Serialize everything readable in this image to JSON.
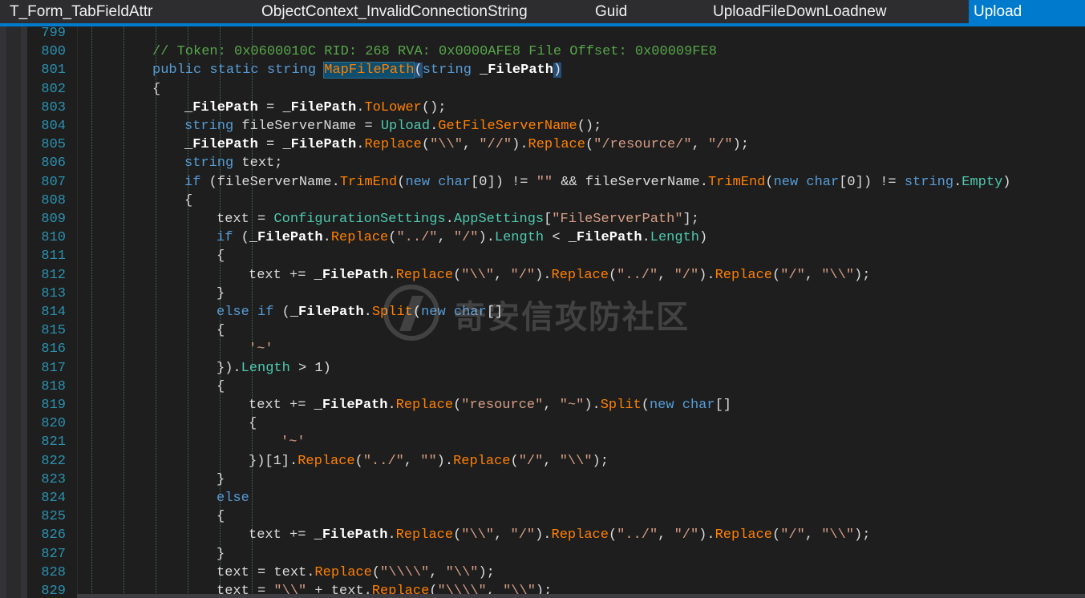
{
  "tabs": [
    {
      "label": "T_Form_TabFieldAttr",
      "active": false
    },
    {
      "label": "ObjectContext_InvalidConnectionString",
      "active": false
    },
    {
      "label": "Guid",
      "active": false
    },
    {
      "label": "UploadFileDownLoadnew",
      "active": false
    },
    {
      "label": "Upload",
      "active": true
    }
  ],
  "colors": {
    "keyword": "#569cd6",
    "comment": "#57a64a",
    "string": "#d69d85",
    "method": "#ff8000",
    "type": "#4ec9b0",
    "line_number": "#2b91af",
    "active_tab": "#007acc"
  },
  "watermark": {
    "text": "奇安信攻防社区",
    "icon": "qianxin-logo-icon"
  },
  "editor": {
    "lines": [
      {
        "n": "799",
        "indent": 0,
        "tokens": []
      },
      {
        "n": "800",
        "indent": 2,
        "tokens": [
          [
            "cm",
            "// Token: 0x0600010C RID: 268 RVA: 0x0000AFE8 File Offset: 0x00009FE8"
          ]
        ]
      },
      {
        "n": "801",
        "indent": 2,
        "tokens": [
          [
            "kw",
            "public"
          ],
          [
            "",
            " "
          ],
          [
            "kw",
            "static"
          ],
          [
            "",
            " "
          ],
          [
            "kw",
            "string"
          ],
          [
            "",
            " "
          ],
          [
            "me hl",
            "MapFilePath"
          ],
          [
            "hl2",
            "("
          ],
          [
            "kw",
            "string"
          ],
          [
            "",
            " "
          ],
          [
            "pa",
            "_FilePath"
          ],
          [
            "hl2",
            ")"
          ]
        ]
      },
      {
        "n": "802",
        "indent": 2,
        "tokens": [
          [
            "",
            "{"
          ]
        ]
      },
      {
        "n": "803",
        "indent": 3,
        "tokens": [
          [
            "pa",
            "_FilePath"
          ],
          [
            "",
            " = "
          ],
          [
            "pa",
            "_FilePath"
          ],
          [
            "",
            "."
          ],
          [
            "me",
            "ToLower"
          ],
          [
            "",
            "();"
          ]
        ]
      },
      {
        "n": "804",
        "indent": 3,
        "tokens": [
          [
            "kw",
            "string"
          ],
          [
            "",
            " fileServerName = "
          ],
          [
            "ty",
            "Upload"
          ],
          [
            "",
            "."
          ],
          [
            "me",
            "GetFileServerName"
          ],
          [
            "",
            "();"
          ]
        ]
      },
      {
        "n": "805",
        "indent": 3,
        "tokens": [
          [
            "pa",
            "_FilePath"
          ],
          [
            "",
            " = "
          ],
          [
            "pa",
            "_FilePath"
          ],
          [
            "",
            "."
          ],
          [
            "me",
            "Replace"
          ],
          [
            "",
            "("
          ],
          [
            "st",
            "\"\\\\\""
          ],
          [
            "",
            ", "
          ],
          [
            "st",
            "\"//\""
          ],
          [
            "",
            ")."
          ],
          [
            "me",
            "Replace"
          ],
          [
            "",
            "("
          ],
          [
            "st",
            "\"/resource/\""
          ],
          [
            "",
            ", "
          ],
          [
            "st",
            "\"/\""
          ],
          [
            "",
            ");"
          ]
        ]
      },
      {
        "n": "806",
        "indent": 3,
        "tokens": [
          [
            "kw",
            "string"
          ],
          [
            "",
            " text;"
          ]
        ]
      },
      {
        "n": "807",
        "indent": 3,
        "tokens": [
          [
            "kw",
            "if"
          ],
          [
            "",
            " (fileServerName."
          ],
          [
            "me",
            "TrimEnd"
          ],
          [
            "",
            "("
          ],
          [
            "kw",
            "new"
          ],
          [
            "",
            " "
          ],
          [
            "kw",
            "char"
          ],
          [
            "",
            "[0]) != "
          ],
          [
            "st",
            "\"\""
          ],
          [
            "",
            " && fileServerName."
          ],
          [
            "me",
            "TrimEnd"
          ],
          [
            "",
            "("
          ],
          [
            "kw",
            "new"
          ],
          [
            "",
            " "
          ],
          [
            "kw",
            "char"
          ],
          [
            "",
            "[0]) != "
          ],
          [
            "kw",
            "string"
          ],
          [
            "",
            "."
          ],
          [
            "pr",
            "Empty"
          ],
          [
            "",
            ")"
          ]
        ]
      },
      {
        "n": "808",
        "indent": 3,
        "tokens": [
          [
            "",
            "{"
          ]
        ]
      },
      {
        "n": "809",
        "indent": 4,
        "tokens": [
          [
            "",
            "text = "
          ],
          [
            "ty",
            "ConfigurationSettings"
          ],
          [
            "",
            "."
          ],
          [
            "pr",
            "AppSettings"
          ],
          [
            "",
            "["
          ],
          [
            "st",
            "\"FileServerPath\""
          ],
          [
            "",
            "];"
          ]
        ]
      },
      {
        "n": "810",
        "indent": 4,
        "tokens": [
          [
            "kw",
            "if"
          ],
          [
            "",
            " ("
          ],
          [
            "pa",
            "_FilePath"
          ],
          [
            "",
            "."
          ],
          [
            "me",
            "Replace"
          ],
          [
            "",
            "("
          ],
          [
            "st",
            "\"../\""
          ],
          [
            "",
            ", "
          ],
          [
            "st",
            "\"/\""
          ],
          [
            "",
            ")."
          ],
          [
            "pr",
            "Length"
          ],
          [
            "",
            " < "
          ],
          [
            "pa",
            "_FilePath"
          ],
          [
            "",
            "."
          ],
          [
            "pr",
            "Length"
          ],
          [
            "",
            ")"
          ]
        ]
      },
      {
        "n": "811",
        "indent": 4,
        "tokens": [
          [
            "",
            "{"
          ]
        ]
      },
      {
        "n": "812",
        "indent": 5,
        "tokens": [
          [
            "",
            "text += "
          ],
          [
            "pa",
            "_FilePath"
          ],
          [
            "",
            "."
          ],
          [
            "me",
            "Replace"
          ],
          [
            "",
            "("
          ],
          [
            "st",
            "\"\\\\\""
          ],
          [
            "",
            ", "
          ],
          [
            "st",
            "\"/\""
          ],
          [
            "",
            ")."
          ],
          [
            "me",
            "Replace"
          ],
          [
            "",
            "("
          ],
          [
            "st",
            "\"../\""
          ],
          [
            "",
            ", "
          ],
          [
            "st",
            "\"/\""
          ],
          [
            "",
            ")."
          ],
          [
            "me",
            "Replace"
          ],
          [
            "",
            "("
          ],
          [
            "st",
            "\"/\""
          ],
          [
            "",
            ", "
          ],
          [
            "st",
            "\"\\\\\""
          ],
          [
            "",
            ");"
          ]
        ]
      },
      {
        "n": "813",
        "indent": 4,
        "tokens": [
          [
            "",
            "}"
          ]
        ]
      },
      {
        "n": "814",
        "indent": 4,
        "tokens": [
          [
            "kw",
            "else"
          ],
          [
            "",
            " "
          ],
          [
            "kw",
            "if"
          ],
          [
            "",
            " ("
          ],
          [
            "pa",
            "_FilePath"
          ],
          [
            "",
            "."
          ],
          [
            "me",
            "Split"
          ],
          [
            "",
            "("
          ],
          [
            "kw",
            "new"
          ],
          [
            "",
            " "
          ],
          [
            "kw",
            "char"
          ],
          [
            "",
            "[]"
          ]
        ]
      },
      {
        "n": "815",
        "indent": 4,
        "tokens": [
          [
            "",
            "{"
          ]
        ]
      },
      {
        "n": "816",
        "indent": 5,
        "tokens": [
          [
            "st",
            "'~'"
          ]
        ]
      },
      {
        "n": "817",
        "indent": 4,
        "tokens": [
          [
            "",
            "})."
          ],
          [
            "pr",
            "Length"
          ],
          [
            "",
            " > 1)"
          ]
        ]
      },
      {
        "n": "818",
        "indent": 4,
        "tokens": [
          [
            "",
            "{"
          ]
        ]
      },
      {
        "n": "819",
        "indent": 5,
        "tokens": [
          [
            "",
            "text += "
          ],
          [
            "pa",
            "_FilePath"
          ],
          [
            "",
            "."
          ],
          [
            "me",
            "Replace"
          ],
          [
            "",
            "("
          ],
          [
            "st",
            "\"resource\""
          ],
          [
            "",
            ", "
          ],
          [
            "st",
            "\"~\""
          ],
          [
            "",
            ")."
          ],
          [
            "me",
            "Split"
          ],
          [
            "",
            "("
          ],
          [
            "kw",
            "new"
          ],
          [
            "",
            " "
          ],
          [
            "kw",
            "char"
          ],
          [
            "",
            "[]"
          ]
        ]
      },
      {
        "n": "820",
        "indent": 5,
        "tokens": [
          [
            "",
            "{"
          ]
        ]
      },
      {
        "n": "821",
        "indent": 6,
        "tokens": [
          [
            "st",
            "'~'"
          ]
        ]
      },
      {
        "n": "822",
        "indent": 5,
        "tokens": [
          [
            "",
            "})[1]."
          ],
          [
            "me",
            "Replace"
          ],
          [
            "",
            "("
          ],
          [
            "st",
            "\"../\""
          ],
          [
            "",
            ", "
          ],
          [
            "st",
            "\"\""
          ],
          [
            "",
            ")."
          ],
          [
            "me",
            "Replace"
          ],
          [
            "",
            "("
          ],
          [
            "st",
            "\"/\""
          ],
          [
            "",
            ", "
          ],
          [
            "st",
            "\"\\\\\""
          ],
          [
            "",
            ");"
          ]
        ]
      },
      {
        "n": "823",
        "indent": 4,
        "tokens": [
          [
            "",
            "}"
          ]
        ]
      },
      {
        "n": "824",
        "indent": 4,
        "tokens": [
          [
            "kw",
            "else"
          ]
        ]
      },
      {
        "n": "825",
        "indent": 4,
        "tokens": [
          [
            "",
            "{"
          ]
        ]
      },
      {
        "n": "826",
        "indent": 5,
        "tokens": [
          [
            "",
            "text += "
          ],
          [
            "pa",
            "_FilePath"
          ],
          [
            "",
            "."
          ],
          [
            "me",
            "Replace"
          ],
          [
            "",
            "("
          ],
          [
            "st",
            "\"\\\\\""
          ],
          [
            "",
            ", "
          ],
          [
            "st",
            "\"/\""
          ],
          [
            "",
            ")."
          ],
          [
            "me",
            "Replace"
          ],
          [
            "",
            "("
          ],
          [
            "st",
            "\"../\""
          ],
          [
            "",
            ", "
          ],
          [
            "st",
            "\"/\""
          ],
          [
            "",
            ")."
          ],
          [
            "me",
            "Replace"
          ],
          [
            "",
            "("
          ],
          [
            "st",
            "\"/\""
          ],
          [
            "",
            ", "
          ],
          [
            "st",
            "\"\\\\\""
          ],
          [
            "",
            ");"
          ]
        ]
      },
      {
        "n": "827",
        "indent": 4,
        "tokens": [
          [
            "",
            "}"
          ]
        ]
      },
      {
        "n": "828",
        "indent": 4,
        "tokens": [
          [
            "",
            "text = text."
          ],
          [
            "me",
            "Replace"
          ],
          [
            "",
            "("
          ],
          [
            "st",
            "\"\\\\\\\\\""
          ],
          [
            "",
            ", "
          ],
          [
            "st",
            "\"\\\\\""
          ],
          [
            "",
            ");"
          ]
        ]
      },
      {
        "n": "829",
        "indent": 4,
        "tokens": [
          [
            "",
            "text = "
          ],
          [
            "st",
            "\"\\\\\""
          ],
          [
            "",
            " + text."
          ],
          [
            "me",
            "Replace"
          ],
          [
            "",
            "("
          ],
          [
            "st",
            "\"\\\\\\\\\""
          ],
          [
            "",
            ", "
          ],
          [
            "st",
            "\"\\\\\""
          ],
          [
            "",
            ");"
          ]
        ]
      }
    ]
  }
}
